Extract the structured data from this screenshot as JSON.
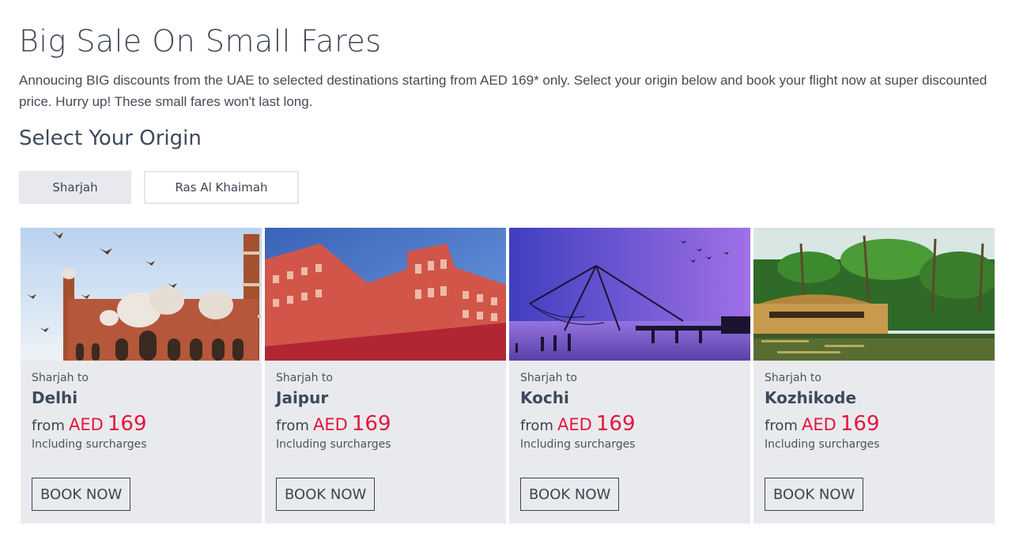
{
  "page": {
    "title": "Big Sale On Small Fares",
    "intro": "Annoucing BIG discounts from the UAE to selected destinations starting from AED 169* only. Select your origin below and book your flight now at super discounted price. Hurry up! These small fares won't last long."
  },
  "origin": {
    "heading": "Select Your Origin",
    "tabs": [
      {
        "label": "Sharjah",
        "active": true
      },
      {
        "label": "Ras Al Khaimah",
        "active": false
      }
    ]
  },
  "deals": [
    {
      "origin_text": "Sharjah to",
      "destination": "Delhi",
      "from_label": "from",
      "currency": "AED",
      "amount": "169",
      "note": "Including surcharges",
      "button": "BOOK NOW",
      "image_icon": "mosque-image"
    },
    {
      "origin_text": "Sharjah to",
      "destination": "Jaipur",
      "from_label": "from",
      "currency": "AED",
      "amount": "169",
      "note": "Including surcharges",
      "button": "BOOK NOW",
      "image_icon": "palace-image"
    },
    {
      "origin_text": "Sharjah to",
      "destination": "Kochi",
      "from_label": "from",
      "currency": "AED",
      "amount": "169",
      "note": "Including surcharges",
      "button": "BOOK NOW",
      "image_icon": "fishing-net-image"
    },
    {
      "origin_text": "Sharjah to",
      "destination": "Kozhikode",
      "from_label": "from",
      "currency": "AED",
      "amount": "169",
      "note": "Including surcharges",
      "button": "BOOK NOW",
      "image_icon": "houseboat-image"
    }
  ],
  "colors": {
    "accent_price": "#e3163c",
    "card_bg": "#e9eaee",
    "text": "#3d4451"
  }
}
